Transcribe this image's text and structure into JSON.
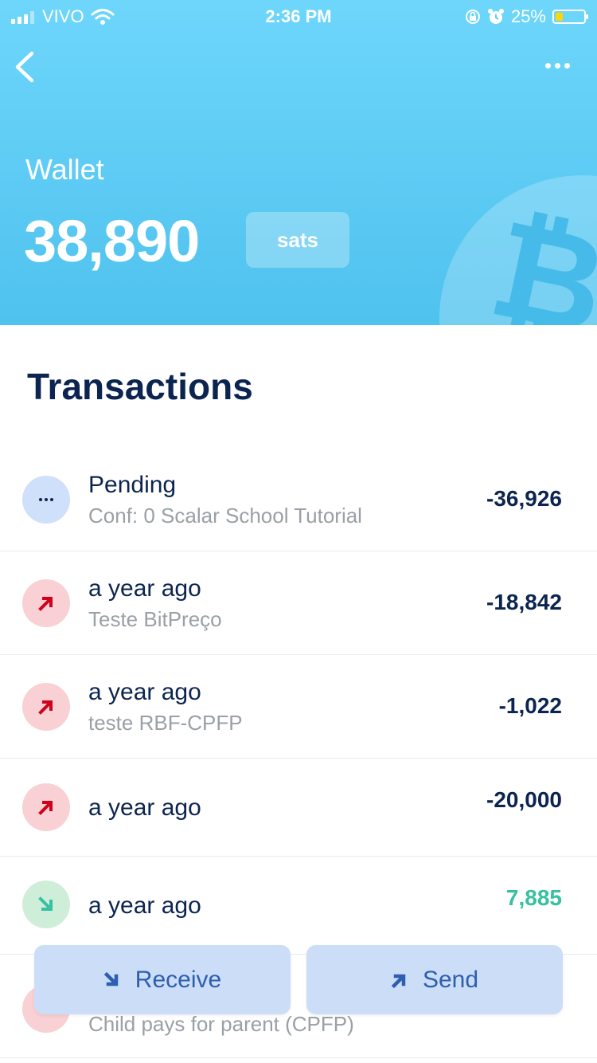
{
  "status_bar": {
    "carrier": "VIVO",
    "time": "2:36 PM",
    "battery": "25%",
    "battery_level": 0.25
  },
  "header": {
    "title": "Wallet",
    "balance": "38,890",
    "unit": "sats",
    "coin_glyph": "₿",
    "icons": [
      "back-chevron-icon",
      "more-icon",
      "bitcoin-icon"
    ]
  },
  "transactions": {
    "title": "Transactions",
    "items": [
      {
        "type": "pending",
        "title": "Pending",
        "memo": "Conf: 0 Scalar School Tutorial",
        "amount": "-36,926"
      },
      {
        "type": "out",
        "title": "a year ago",
        "memo": "Teste BitPreço",
        "amount": "-18,842"
      },
      {
        "type": "out",
        "title": "a year ago",
        "memo": "teste RBF-CPFP",
        "amount": "-1,022"
      },
      {
        "type": "out",
        "title": "a year ago",
        "memo": "",
        "amount": "-20,000"
      },
      {
        "type": "in",
        "title": "a year ago",
        "memo": "",
        "amount": "7,885"
      },
      {
        "type": "out",
        "title": "",
        "memo": "Child pays for parent (CPFP)",
        "amount": ""
      }
    ]
  },
  "actions": {
    "receive_label": "Receive",
    "send_label": "Send"
  },
  "colors": {
    "header_top": "#6ed6fb",
    "header_bottom": "#4fc2ee",
    "navy": "#0c2550",
    "out_red": "#d0021b",
    "in_green": "#37c0a1",
    "action_blue": "#2e5eaf"
  }
}
